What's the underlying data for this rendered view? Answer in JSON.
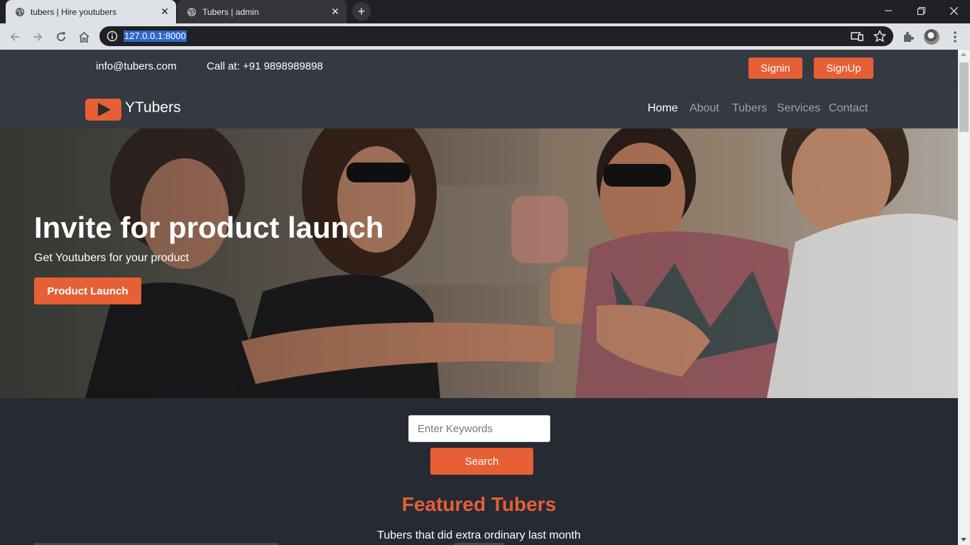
{
  "browser": {
    "tabs": [
      {
        "title": "tubers | Hire youtubers",
        "active": true
      },
      {
        "title": "Tubers | admin",
        "active": false
      }
    ],
    "url": "127.0.0.1:8000",
    "icons": [
      "globe-icon",
      "close-icon",
      "plus-icon",
      "minimize-icon",
      "restore-icon",
      "close-window-icon",
      "back-icon",
      "forward-icon",
      "reload-icon",
      "home-icon",
      "info-icon",
      "cast-icon",
      "star-icon",
      "extensions-icon",
      "profile-avatar",
      "menu-icon"
    ]
  },
  "topbar": {
    "email": "info@tubers.com",
    "phone": "Call at: +91 9898989898",
    "signin_label": "Signin",
    "signup_label": "SignUp"
  },
  "navbar": {
    "logo_text": "YTubers",
    "links": [
      {
        "label": "Home",
        "active": true
      },
      {
        "label": "About",
        "active": false
      },
      {
        "label": "Tubers",
        "active": false
      },
      {
        "label": "Services",
        "active": false
      },
      {
        "label": "Contact",
        "active": false
      }
    ]
  },
  "hero": {
    "title": "Invite for product launch",
    "subtitle": "Get Youtubers for your product",
    "cta_label": "Product Launch"
  },
  "search": {
    "placeholder": "Enter Keywords",
    "button_label": "Search"
  },
  "featured": {
    "title": "Featured Tubers",
    "subtitle": "Tubers that did extra ordinary last month"
  },
  "colors": {
    "accent": "#e65f35",
    "page_bg": "#262a33",
    "header_bg": "#353941"
  }
}
